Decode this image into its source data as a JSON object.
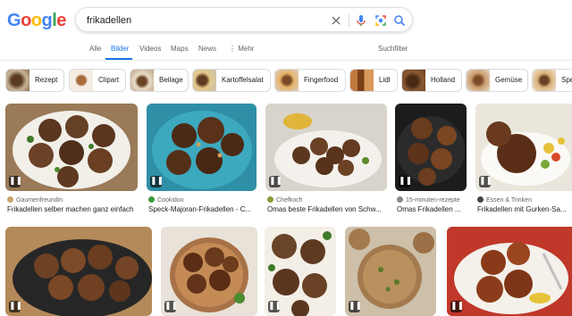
{
  "search": {
    "query": "frikadellen"
  },
  "logo": {
    "letters": [
      "G",
      "o",
      "o",
      "g",
      "l",
      "e"
    ],
    "colors": [
      "#4285f4",
      "#ea4335",
      "#fbbc05",
      "#4285f4",
      "#34a853",
      "#ea4335"
    ]
  },
  "tabs": [
    {
      "label": "Alle"
    },
    {
      "label": "Bilder"
    },
    {
      "label": "Videos"
    },
    {
      "label": "Maps"
    },
    {
      "label": "News"
    },
    {
      "label": "Mehr"
    }
  ],
  "more_icon": "three-dots-vertical-icon",
  "filter_label": "Suchfilter",
  "chips": [
    {
      "label": "Rezept"
    },
    {
      "label": "Clipart"
    },
    {
      "label": "Beilage"
    },
    {
      "label": "Kartoffelsalat"
    },
    {
      "label": "Fingerfood"
    },
    {
      "label": "Lidl"
    },
    {
      "label": "Holland"
    },
    {
      "label": "Gemüse"
    },
    {
      "label": "Spe"
    }
  ],
  "results_row1": [
    {
      "source": "Gaumenfreundin",
      "title": "Frikadellen selber machen ganz einfach"
    },
    {
      "source": "Cookidoo",
      "title": "Speck-Majoran-Frikadellen - C..."
    },
    {
      "source": "Chefkoch",
      "title": "Omas beste Frikadellen von Schw..."
    },
    {
      "source": "15-minuten-rezepte",
      "title": "Omas Frikadellen ..."
    },
    {
      "source": "Essen & Trinken",
      "title": "Frikadellen mit Gurken-Sa..."
    }
  ],
  "badge_glyph": "❚❚",
  "colors": {
    "accent": "#1a73e8",
    "text_muted": "#5f6368"
  }
}
